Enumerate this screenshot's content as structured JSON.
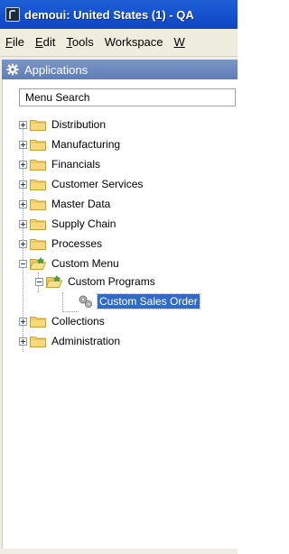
{
  "window": {
    "title": "demoui: United States (1) - QA"
  },
  "menubar": {
    "items": [
      {
        "underline": "F",
        "rest": "ile"
      },
      {
        "underline": "E",
        "rest": "dit"
      },
      {
        "underline": "T",
        "rest": "ools"
      },
      {
        "underline": "",
        "rest": "Workspace"
      },
      {
        "underline": "W",
        "rest": ""
      }
    ]
  },
  "applications": {
    "header": "Applications",
    "search_placeholder": "Menu Search"
  },
  "tree": {
    "distribution": "Distribution",
    "manufacturing": "Manufacturing",
    "financials": "Financials",
    "customer_services": "Customer Services",
    "master_data": "Master Data",
    "supply_chain": "Supply Chain",
    "processes": "Processes",
    "custom_menu": "Custom Menu",
    "custom_programs": "Custom Programs",
    "custom_sales_order": "Custom Sales Order",
    "collections": "Collections",
    "administration": "Administration"
  },
  "colors": {
    "titlebar": "#1755d2",
    "selection": "#316ac5",
    "folder": "#f5d76e",
    "header": "#6a88c0"
  }
}
